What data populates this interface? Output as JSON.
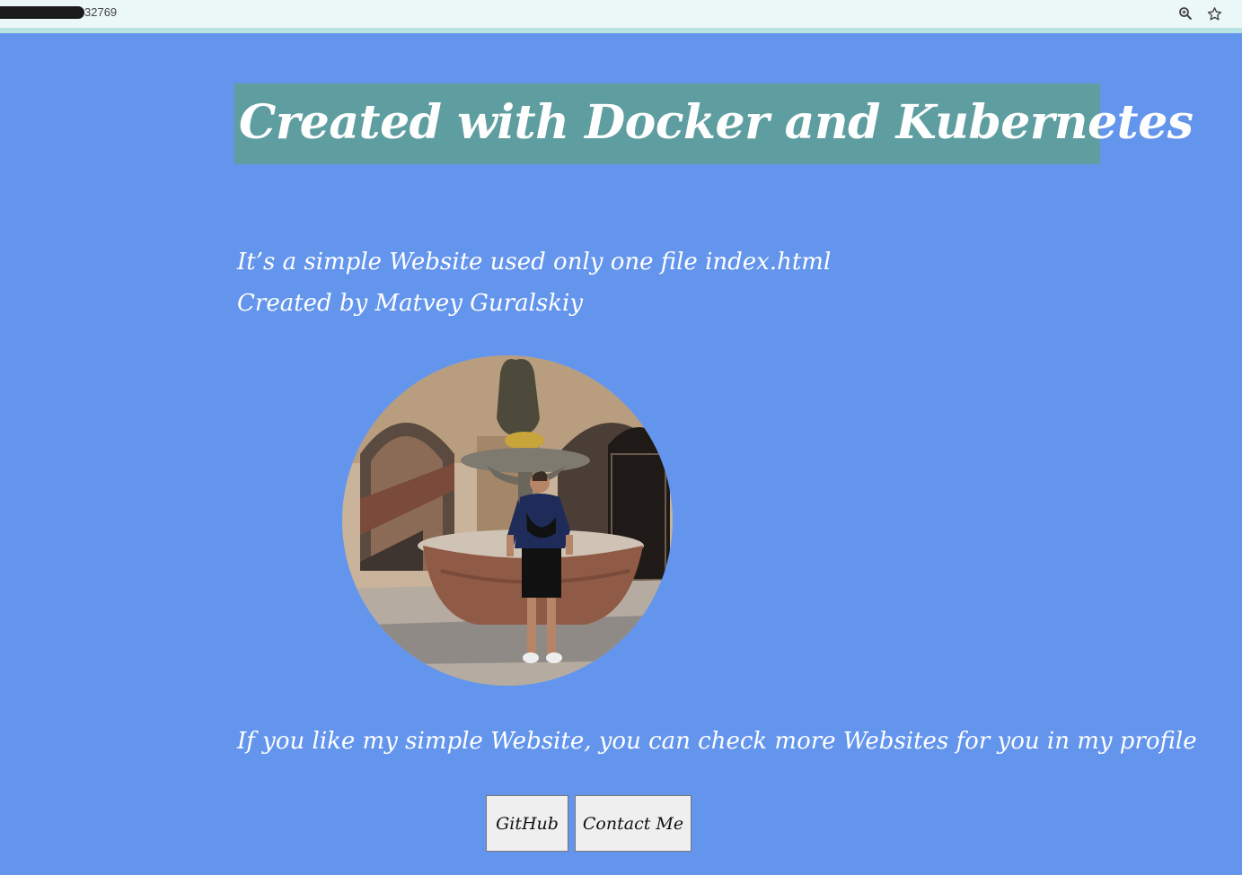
{
  "browser": {
    "url_visible": "32769",
    "zoom_icon": "zoom-icon",
    "bookmark_icon": "star-icon"
  },
  "page": {
    "heading": "Created with Docker and Kubernetes",
    "description_lines": [
      "It’s a simple Website used only one file index.html",
      "Created by Matvey Guralskiy"
    ],
    "photo_icon": "profile-photo",
    "profile_text": "If you like my simple Website, you can check more Websites for you in my profile",
    "buttons": {
      "github": "GitHub",
      "contact": "Contact Me"
    }
  },
  "colors": {
    "background": "#6495ED",
    "heading_bg": "#5F9EA0",
    "text": "#FFFFFF",
    "button_bg": "#EFEFEF"
  }
}
